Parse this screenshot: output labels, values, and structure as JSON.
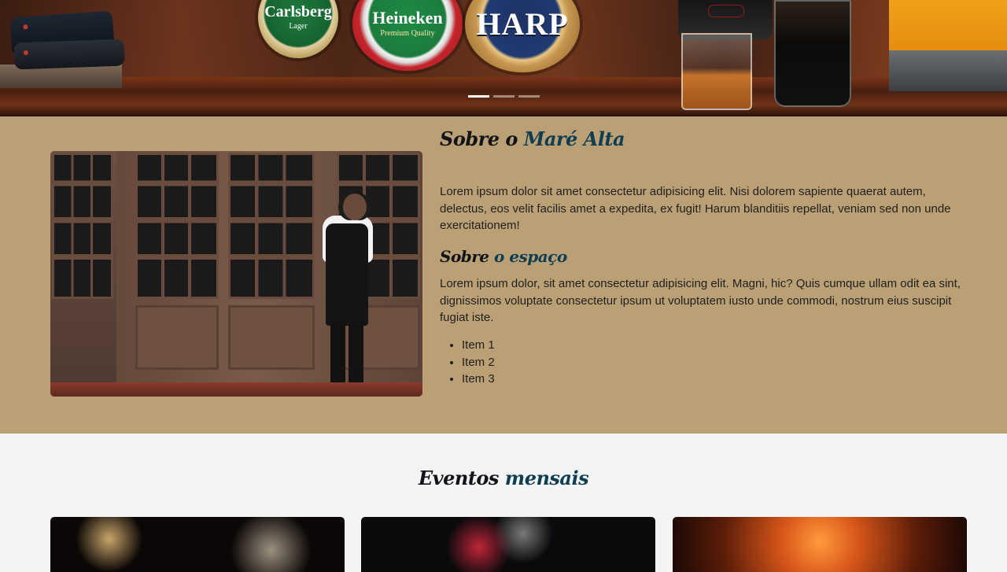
{
  "hero": {
    "taps": [
      {
        "name": "Carlsberg",
        "label": "Carlsberg",
        "sub": "Lager"
      },
      {
        "name": "Heineken",
        "label": "Heineken",
        "sub": "Premium Quality"
      },
      {
        "name": "Harp",
        "label": "HARP",
        "sub": ""
      }
    ],
    "indicators": [
      {
        "active": true
      },
      {
        "active": false
      },
      {
        "active": false
      }
    ]
  },
  "about": {
    "title_part1": "Sobre o ",
    "title_part2": "Maré Alta",
    "paragraph1": "Lorem ipsum dolor sit amet consectetur adipisicing elit. Nisi dolorem sapiente quaerat autem, delectus, eos velit facilis amet a expedita, ex fugit! Harum blanditiis repellat, veniam sed non unde exercitationem!",
    "subtitle_part1": "Sobre ",
    "subtitle_part2": "o espaço",
    "paragraph2": "Lorem ipsum dolor, sit amet consectetur adipisicing elit. Magni, hic? Quis cumque ullam odit ea sint, dignissimos voluptate consectetur ipsum ut voluptatem iusto unde commodi, nostrum eius suscipit fugiat iste.",
    "items": [
      "Item 1",
      "Item 2",
      "Item 3"
    ]
  },
  "events": {
    "title_part1": "Eventos ",
    "title_part2": "mensais"
  }
}
